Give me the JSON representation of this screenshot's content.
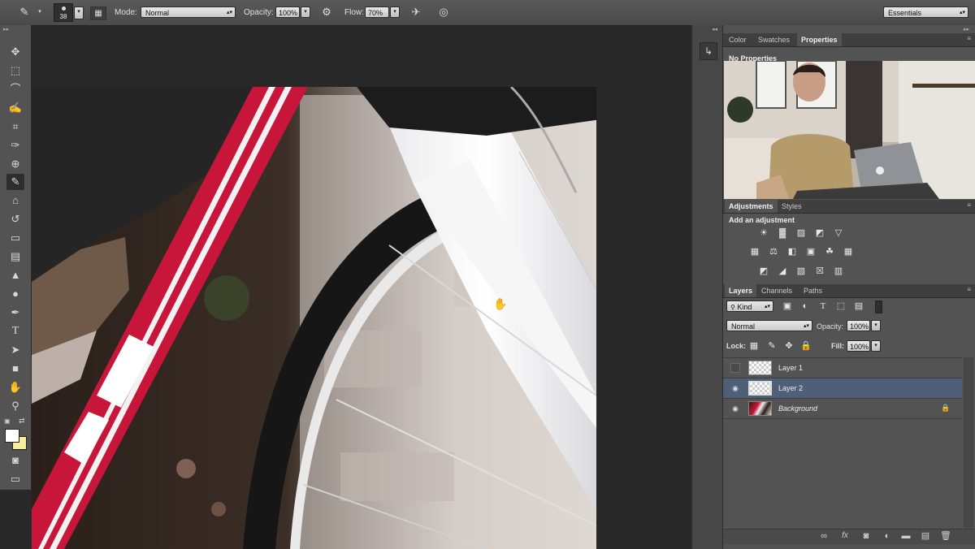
{
  "options_bar": {
    "brush_size": "38",
    "mode_label": "Mode:",
    "mode_value": "Normal",
    "opacity_label": "Opacity:",
    "opacity_value": "100%",
    "flow_label": "Flow:",
    "flow_value": "70%",
    "workspace": "Essentials"
  },
  "top_panel": {
    "tabs": [
      "Color",
      "Swatches",
      "Properties"
    ],
    "active_tab": "Properties",
    "message": "No Properties"
  },
  "adjustments": {
    "tabs": [
      "Adjustments",
      "Styles"
    ],
    "title": "Add an adjustment",
    "icons_row1": [
      "brightness-contrast-icon",
      "levels-icon",
      "curves-icon",
      "exposure-icon",
      "vibrance-icon"
    ],
    "icons_row2": [
      "hue-saturation-icon",
      "color-balance-icon",
      "black-white-icon",
      "photo-filter-icon",
      "channel-mixer-icon",
      "color-lookup-icon"
    ],
    "icons_row3": [
      "invert-icon",
      "posterize-icon",
      "threshold-icon",
      "selective-color-icon",
      "gradient-map-icon"
    ]
  },
  "layers_panel": {
    "tabs": [
      "Layers",
      "Channels",
      "Paths"
    ],
    "filter_label": "Kind",
    "blend_mode": "Normal",
    "opacity_label": "Opacity:",
    "opacity_value": "100%",
    "lock_label": "Lock:",
    "fill_label": "Fill:",
    "fill_value": "100%",
    "layers": [
      {
        "name": "Layer 1",
        "visible": false,
        "selected": false
      },
      {
        "name": "Layer 2",
        "visible": true,
        "selected": true
      },
      {
        "name": "Background",
        "visible": true,
        "selected": false,
        "locked": true
      }
    ]
  },
  "colors": {
    "selected_layer": "#4f5f78",
    "foreground": "#ffffff",
    "background": "#f5ee9a"
  }
}
